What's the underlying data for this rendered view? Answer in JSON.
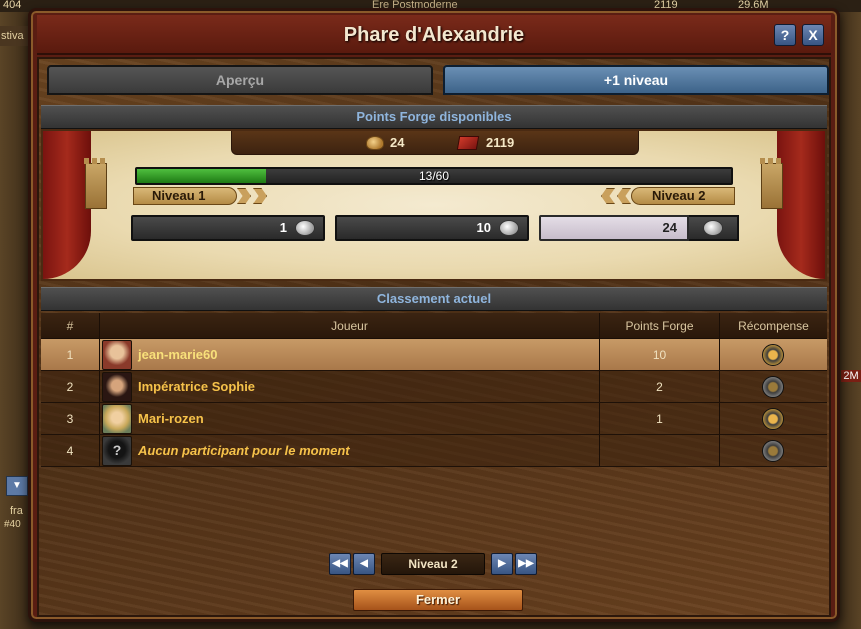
{
  "background": {
    "top_left_number": "404",
    "age_label": "Ère Postmoderne",
    "resource_1": "2119",
    "resource_2": "29.6M",
    "left_label": "stiva",
    "player_tag": "fra",
    "player_rank": "#40",
    "right_label": "2M"
  },
  "window": {
    "title": "Phare d'Alexandrie",
    "help_label": "?",
    "close_label": "X"
  },
  "tabs": [
    {
      "label": "Aperçu",
      "active": false
    },
    {
      "label": "+1 niveau",
      "active": true
    }
  ],
  "forge": {
    "header": "Points Forge disponibles",
    "forge_points": "24",
    "goods": "2119",
    "progress_text": "13/60",
    "progress_fraction": 0.2167,
    "level_from": "Niveau 1",
    "level_to": "Niveau 2",
    "contrib_1": "1",
    "contrib_10": "10",
    "contrib_custom_value": "24"
  },
  "ranking": {
    "header": "Classement actuel",
    "columns": {
      "rank": "#",
      "player": "Joueur",
      "fp": "Points Forge",
      "reward": "Récompense"
    },
    "rows": [
      {
        "rank": "1",
        "player": "jean-marie60",
        "fp": "10"
      },
      {
        "rank": "2",
        "player": "Impératrice Sophie",
        "fp": "2"
      },
      {
        "rank": "3",
        "player": "Mari-rozen",
        "fp": "1"
      },
      {
        "rank": "4",
        "player": "Aucun participant pour le moment",
        "fp": ""
      }
    ],
    "placeholder_avatar": "?"
  },
  "pager": {
    "first": "◀◀",
    "prev": "◀",
    "label": "Niveau 2",
    "next": "▶",
    "last": "▶▶"
  },
  "footer": {
    "close_label": "Fermer"
  },
  "colors": {
    "accent_blue": "#3d6389",
    "player_gold": "#f6c24a",
    "close_orange": "#c06a28"
  },
  "icons": [
    "forge-points-icon",
    "goods-icon",
    "reward-icon",
    "help-icon",
    "close-icon"
  ]
}
